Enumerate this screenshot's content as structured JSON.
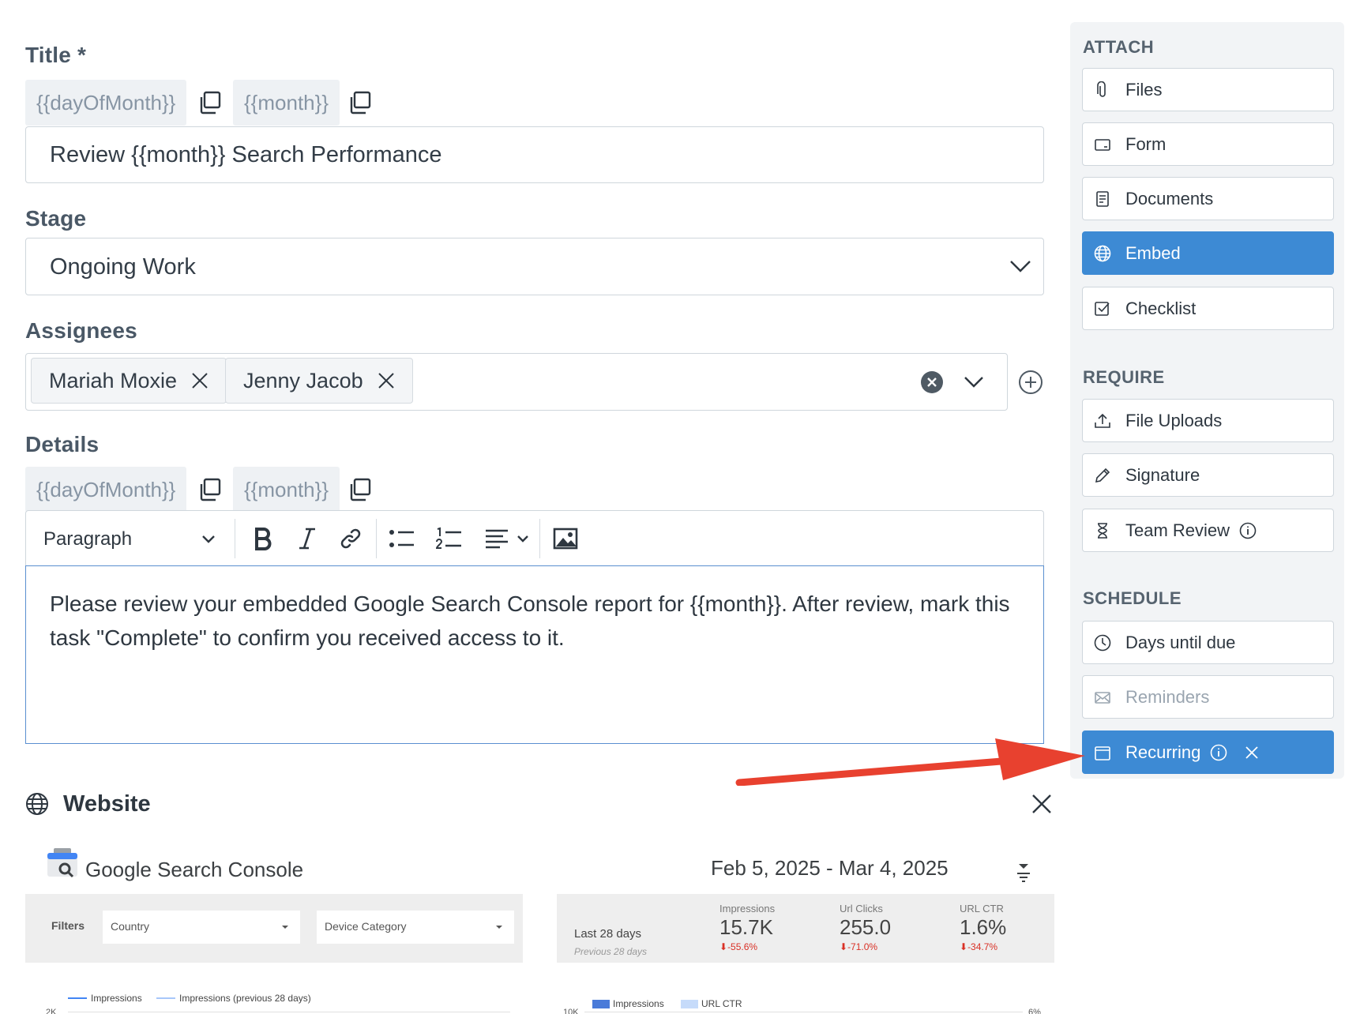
{
  "title_field": {
    "label": "Title *",
    "variables": [
      "{{dayOfMonth}}",
      "{{month}}"
    ],
    "value": "Review {{month}} Search Performance"
  },
  "stage_field": {
    "label": "Stage",
    "value": "Ongoing Work"
  },
  "assignees_field": {
    "label": "Assignees",
    "tags": [
      "Mariah Moxie",
      "Jenny Jacob"
    ]
  },
  "details_field": {
    "label": "Details",
    "variables": [
      "{{dayOfMonth}}",
      "{{month}}"
    ],
    "block_type": "Paragraph",
    "body": "Please review your embedded Google Search Console report for {{month}}. After review,  mark this task \"Complete\" to confirm you received access to it."
  },
  "embed": {
    "title": "Website",
    "report": {
      "name": "Google Search Console",
      "date_range": "Feb 5, 2025 - Mar 4, 2025",
      "filters_label": "Filters",
      "filter_country": "Country",
      "filter_device": "Device Category",
      "period_label": "Last 28 days",
      "period_sub": "Previous 28 days",
      "metrics": [
        {
          "label": "Impressions",
          "value": "15.7K",
          "delta": "-55.6%"
        },
        {
          "label": "Url Clicks",
          "value": "255.0",
          "delta": "-71.0%"
        },
        {
          "label": "URL CTR",
          "value": "1.6%",
          "delta": "-34.7%"
        }
      ],
      "legend_left": [
        "Impressions",
        "Impressions (previous 28 days)"
      ],
      "legend_right": [
        "Impressions",
        "URL CTR"
      ],
      "axis_left_top": "2K",
      "axis_mid_top": "10K",
      "axis_right_top": "6%"
    }
  },
  "sidebar": {
    "attach": {
      "heading": "ATTACH",
      "items": [
        "Files",
        "Form",
        "Documents",
        "Embed",
        "Checklist"
      ]
    },
    "require": {
      "heading": "REQUIRE",
      "items": [
        "File Uploads",
        "Signature",
        "Team Review"
      ]
    },
    "schedule": {
      "heading": "SCHEDULE",
      "items": [
        "Days until due",
        "Reminders",
        "Recurring"
      ]
    }
  },
  "colors": {
    "accent": "#3d8ad4",
    "arrow": "#e8412f"
  }
}
